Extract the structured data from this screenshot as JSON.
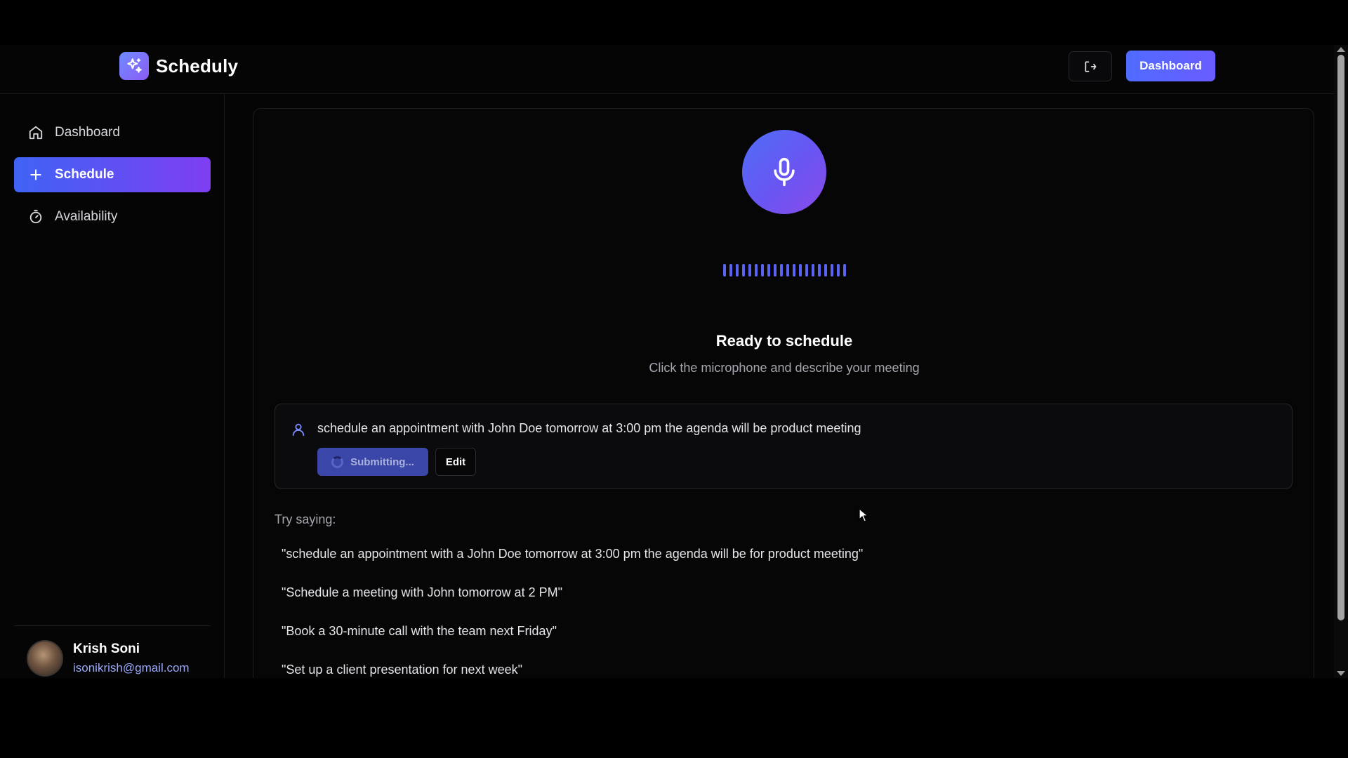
{
  "app": {
    "name": "Scheduly"
  },
  "header": {
    "logout_icon": "logout-icon",
    "dashboard_button": "Dashboard"
  },
  "sidebar": {
    "items": [
      {
        "label": "Dashboard",
        "icon": "home-icon",
        "active": false
      },
      {
        "label": "Schedule",
        "icon": "plus-icon",
        "active": true
      },
      {
        "label": "Availability",
        "icon": "timer-icon",
        "active": false
      }
    ],
    "user": {
      "name": "Krish Soni",
      "email": "isonikrish@gmail.com"
    }
  },
  "main": {
    "mic_icon": "microphone-icon",
    "status_title": "Ready to schedule",
    "status_subtitle": "Click the microphone and describe your meeting",
    "transcript": {
      "text": "schedule an appointment with John Doe tomorrow at 3:00 pm the agenda will be product meeting",
      "submit_label": "Submitting...",
      "edit_label": "Edit"
    },
    "try_label": "Try saying:",
    "suggestions": [
      "\"schedule an appointment with a John Doe tomorrow at 3:00 pm the agenda will be for product meeting\"",
      "\"Schedule a meeting with John tomorrow at 2 PM\"",
      "\"Book a 30-minute call with the team next Friday\"",
      "\"Set up a client presentation for next week\""
    ]
  },
  "colors": {
    "accent": "#4f6bff",
    "accent_purple": "#8b5cf6",
    "background": "#050506"
  }
}
